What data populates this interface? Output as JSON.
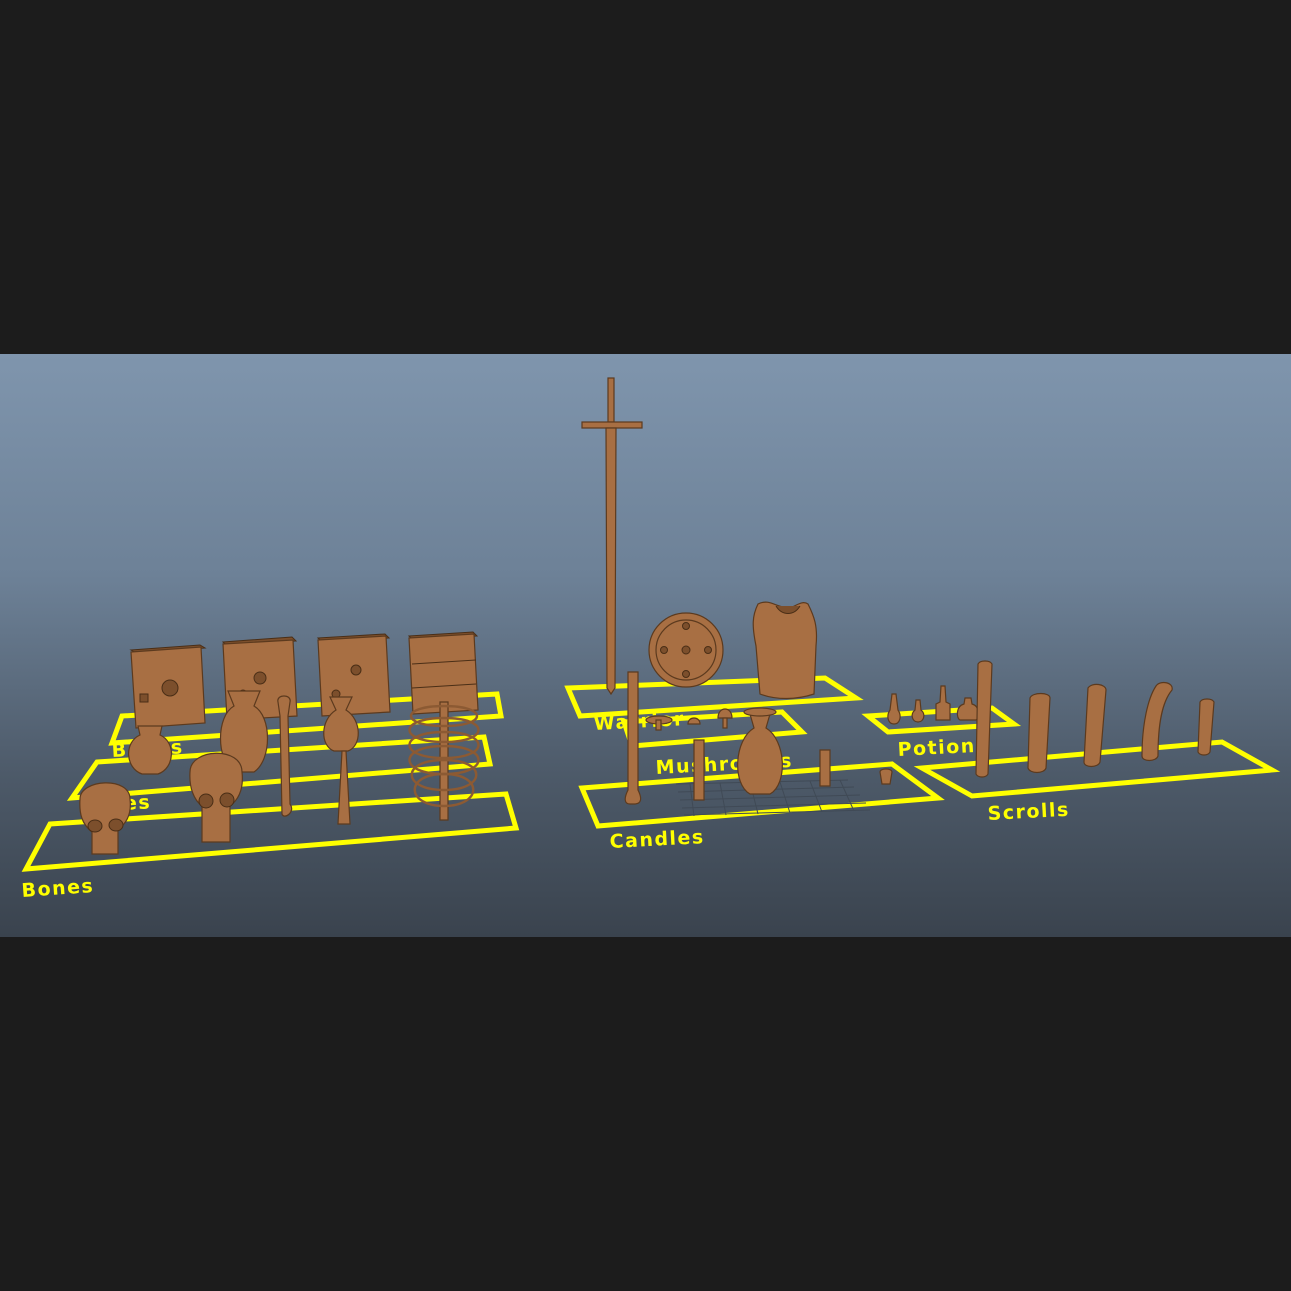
{
  "scene": {
    "background_top": "#7f95ad",
    "background_bottom": "#3a434e",
    "label_color": "#ffff00",
    "model_color": "#a86f43",
    "letterbox_color": "#1c1c1c"
  },
  "groups": {
    "books": "Books",
    "vases": "Vases",
    "bones": "Bones",
    "warrior": "Warrior",
    "mushrooms": "Mushrooms",
    "candles": "Candles",
    "potions": "Potions",
    "scrolls": "Scrolls"
  },
  "icons": {
    "book": "book-icon",
    "vase": "vase-icon",
    "skull": "skull-icon",
    "bone": "bone-icon",
    "ribcage": "ribcage-icon",
    "sword": "sword-icon",
    "shield": "shield-icon",
    "armor": "armor-icon",
    "candle": "candle-icon",
    "potion": "potion-icon",
    "scroll": "scroll-icon",
    "mushroom": "mushroom-icon"
  }
}
